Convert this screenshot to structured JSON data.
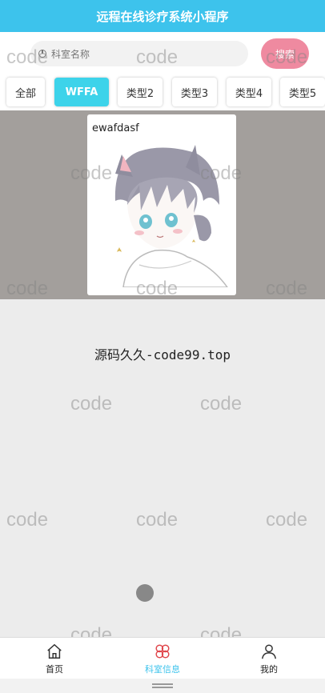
{
  "app": {
    "title": "远程在线诊疗系统小程序"
  },
  "search": {
    "placeholder": "科室名称",
    "button": "搜索"
  },
  "tabs": [
    {
      "label": "全部",
      "active": false
    },
    {
      "label": "WFFA",
      "active": true
    },
    {
      "label": "类型2",
      "active": false
    },
    {
      "label": "类型3",
      "active": false
    },
    {
      "label": "类型4",
      "active": false
    },
    {
      "label": "类型5",
      "active": false
    }
  ],
  "list": [
    {
      "name": "ewafdasf",
      "image": "anime-cat-boy-illustration"
    }
  ],
  "footnote": "源码久久-code99.top",
  "watermark": "code",
  "tabbar": [
    {
      "label": "首页",
      "icon": "home-icon",
      "active": false
    },
    {
      "label": "科室信息",
      "icon": "clover-icon",
      "active": true
    },
    {
      "label": "我的",
      "icon": "user-icon",
      "active": false
    }
  ],
  "colors": {
    "header": "#3dc3ec",
    "active_tab": "#3dd3ea",
    "search_button": "#ef8aa0",
    "tabbar_active": "#3dc3ec"
  }
}
